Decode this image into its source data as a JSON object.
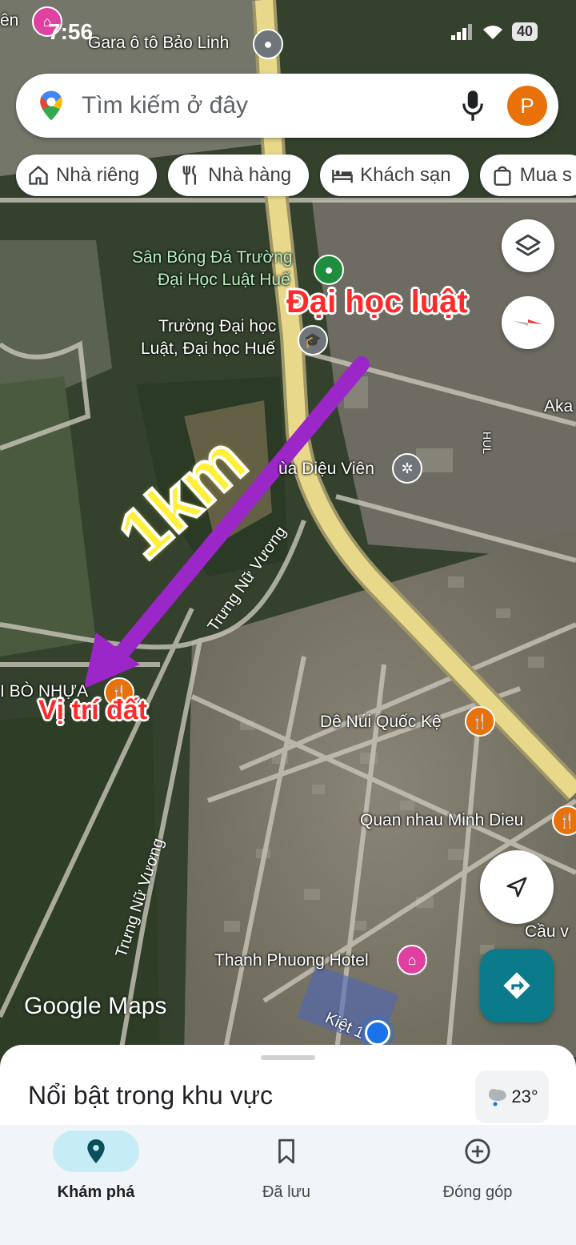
{
  "status_bar": {
    "time": "7:56",
    "battery": "40"
  },
  "search": {
    "placeholder": "Tìm kiếm ở đây",
    "avatar_letter": "P"
  },
  "chips": [
    {
      "label": "Nhà riêng",
      "icon": "home-icon"
    },
    {
      "label": "Nhà hàng",
      "icon": "restaurant-icon"
    },
    {
      "label": "Khách sạn",
      "icon": "hotel-icon"
    },
    {
      "label": "Mua s",
      "icon": "shopping-bag-icon"
    }
  ],
  "map": {
    "labels": {
      "top_left": "ên",
      "gara": "Gara ô tô Bảo Linh",
      "san_bong": "Sân Bóng Đá Trường Đại Học Luật Huế",
      "san_bong_line1": "Sân Bóng Đá Trường",
      "san_bong_line2": "Đại Học Luật Huế",
      "truong_line1": "Trường Đại học",
      "truong_line2": "Luật, Đại học Huế",
      "aka": "Aka",
      "chua": "ùa Diệu Viên",
      "hul": "HUL",
      "road_trung_nu_vuong_1": "Trưng Nữ Vương",
      "road_trung_nu_vuong_2": "Trưng Nữ Vương",
      "bo_nhua": "I BÒ NHỰA",
      "de_nui": "Dê Núi Quốc Kệ",
      "quan_nhau": "Quan nhau Minh Dieu",
      "cau": "Cầu v",
      "hotel": "Thanh Phuong Hotel",
      "kiet": "Kiệt 1"
    },
    "annotations": {
      "dai_hoc_luat": "Đại học luật",
      "distance": "1km",
      "vi_tri_dat": "Vị trí đất"
    },
    "watermark": "Google Maps",
    "colors": {
      "arrow": "#9b27c9",
      "highway": "#e8d98a",
      "annotation_red": "#ff2a2a",
      "km_yellow": "#ffef3a"
    }
  },
  "bottom_sheet": {
    "title": "Nổi bật trong khu vực",
    "temperature": "23°"
  },
  "nav": [
    {
      "label": "Khám phá",
      "icon": "explore-pin-icon",
      "active": true
    },
    {
      "label": "Đã lưu",
      "icon": "bookmark-icon",
      "active": false
    },
    {
      "label": "Đóng góp",
      "icon": "add-circle-icon",
      "active": false
    }
  ]
}
